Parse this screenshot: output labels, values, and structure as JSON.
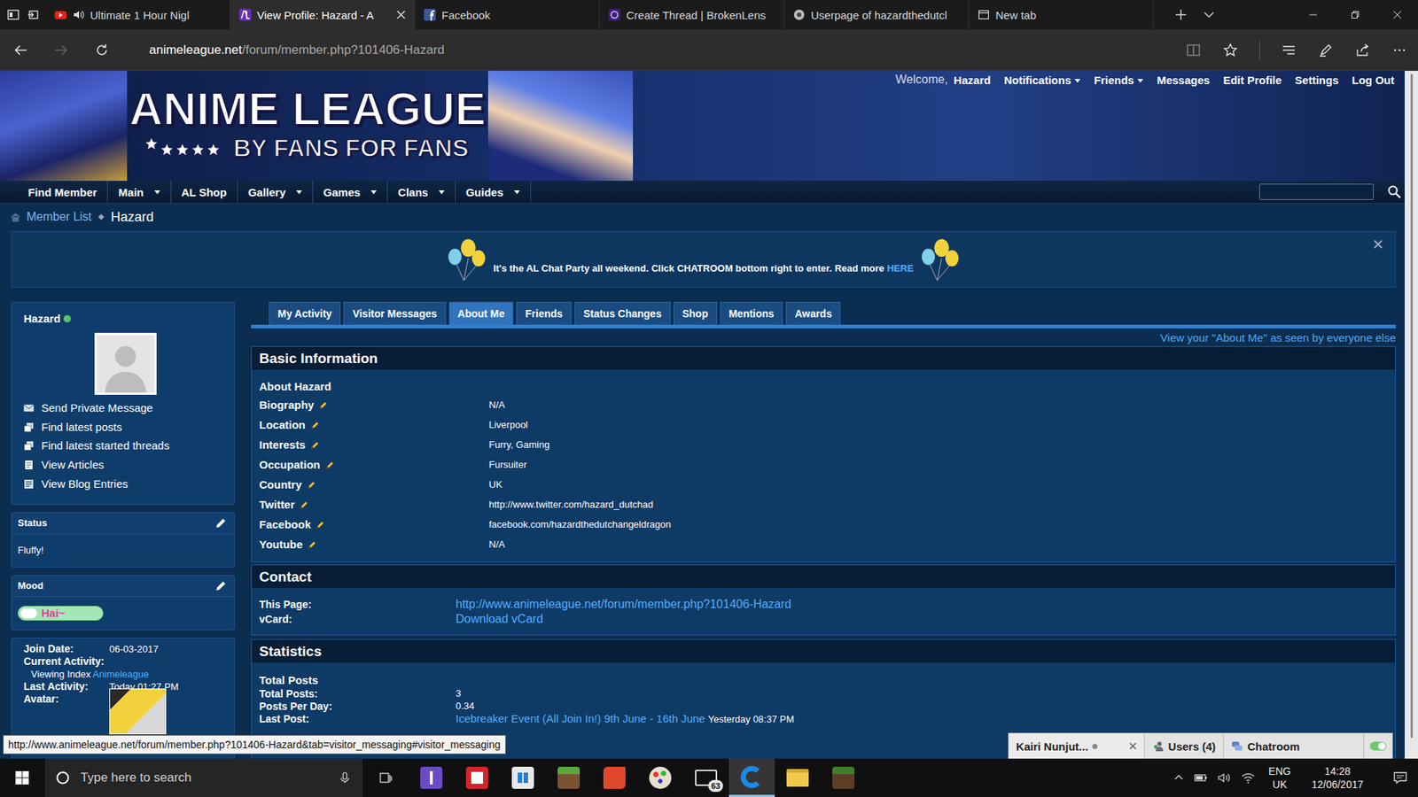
{
  "browser": {
    "tabs": [
      {
        "title": "Ultimate 1 Hour Nigl",
        "kind": "youtube",
        "audio": true,
        "selected": false
      },
      {
        "title": "View Profile: Hazard - A",
        "kind": "animeleague",
        "audio": false,
        "selected": true
      },
      {
        "title": "Facebook",
        "kind": "facebook",
        "audio": false,
        "selected": false
      },
      {
        "title": "Create Thread | BrokenLens",
        "kind": "brokenlens",
        "audio": false,
        "selected": false
      },
      {
        "title": "Userpage of hazardthedutcl",
        "kind": "userpage",
        "audio": false,
        "selected": false
      },
      {
        "title": "New tab",
        "kind": "newtab",
        "audio": false,
        "selected": false
      }
    ],
    "can_go_back": true,
    "can_go_forward": false,
    "url": {
      "host": "animeleague.net",
      "path": "/forum/member.php?101406-Hazard"
    },
    "status_url": "http://www.animeleague.net/forum/member.php?101406-Hazard&tab=visitor_messaging#visitor_messaging"
  },
  "site": {
    "logo": {
      "title": "ANIME LEAGUE",
      "tagline": "BY FANS FOR FANS"
    },
    "welcome": "Welcome,",
    "username": "Hazard",
    "user_links": [
      {
        "label": "Notifications",
        "dropdown": true
      },
      {
        "label": "Friends",
        "dropdown": true
      },
      {
        "label": "Messages",
        "dropdown": false
      },
      {
        "label": "Edit Profile",
        "dropdown": false
      },
      {
        "label": "Settings",
        "dropdown": false
      },
      {
        "label": "Log Out",
        "dropdown": false
      }
    ],
    "nav": [
      {
        "label": "Find Member",
        "dropdown": false
      },
      {
        "label": "Main",
        "dropdown": true
      },
      {
        "label": "AL Shop",
        "dropdown": false
      },
      {
        "label": "Gallery",
        "dropdown": true
      },
      {
        "label": "Games",
        "dropdown": true
      },
      {
        "label": "Clans",
        "dropdown": true
      },
      {
        "label": "Guides",
        "dropdown": true
      }
    ],
    "breadcrumb": [
      {
        "label": "Member List",
        "link": true
      },
      {
        "label": "Hazard",
        "link": false
      }
    ],
    "notice": {
      "text": "It's the AL Chat Party all weekend. Click CHATROOM bottom right to enter. Read more ",
      "link": "HERE"
    }
  },
  "sidebar": {
    "name": "Hazard",
    "online": true,
    "actions": [
      {
        "label": "Send Private Message",
        "kind": "message"
      },
      {
        "label": "Find latest posts",
        "kind": "posts"
      },
      {
        "label": "Find latest started threads",
        "kind": "posts"
      },
      {
        "label": "View Articles",
        "kind": "articles"
      },
      {
        "label": "View Blog Entries",
        "kind": "blog"
      }
    ],
    "boxes": [
      {
        "title": "Status",
        "text": "Fluffy!",
        "kind": "text"
      },
      {
        "title": "Mood",
        "text": "Hai~",
        "kind": "mood"
      }
    ],
    "stats": [
      {
        "kind": "text",
        "label": "Join Date:",
        "value": "06-03-2017"
      },
      {
        "kind": "activity",
        "label": "Current Activity:",
        "detail": "Viewing Index",
        "link": "Animeleague"
      },
      {
        "kind": "text",
        "label": "Last Activity:",
        "value": "Today 01:27 PM"
      },
      {
        "kind": "image",
        "label": "Avatar:"
      }
    ]
  },
  "profile": {
    "tabs": [
      {
        "label": "My Activity",
        "selected": false
      },
      {
        "label": "Visitor Messages",
        "selected": false
      },
      {
        "label": "About Me",
        "selected": true
      },
      {
        "label": "Friends",
        "selected": false
      },
      {
        "label": "Status Changes",
        "selected": false
      },
      {
        "label": "Shop",
        "selected": false
      },
      {
        "label": "Mentions",
        "selected": false
      },
      {
        "label": "Awards",
        "selected": false
      }
    ],
    "view_as_link": "View your \"About Me\" as seen by everyone else",
    "sections": [
      {
        "title": "Basic Information",
        "kind": "editable",
        "subtitle": "About Hazard",
        "rows": [
          {
            "label": "Biography",
            "value": "N/A",
            "link": false
          },
          {
            "label": "Location",
            "value": "Liverpool",
            "link": false
          },
          {
            "label": "Interests",
            "value": "Furry, Gaming",
            "link": false
          },
          {
            "label": "Occupation",
            "value": "Fursuiter",
            "link": false
          },
          {
            "label": "Country",
            "value": "UK",
            "link": false
          },
          {
            "label": "Twitter",
            "value": "http://www.twitter.com/hazard_dutchad",
            "link": false
          },
          {
            "label": "Facebook",
            "value": "facebook.com/hazardthedutchangeldragon",
            "link": false
          },
          {
            "label": "Youtube",
            "value": "N/A",
            "link": false
          }
        ]
      },
      {
        "title": "Contact",
        "kind": "contact",
        "rows": [
          {
            "label": "This Page:",
            "value": "http://www.animeleague.net/forum/member.php?101406-Hazard",
            "link": true
          },
          {
            "label": "vCard:",
            "value": "Download vCard",
            "link": true
          }
        ]
      },
      {
        "title": "Statistics",
        "kind": "stats",
        "subtitle": "Total Posts",
        "rows": [
          {
            "label": "Total Posts:",
            "value": "3",
            "link": false
          },
          {
            "label": "Posts Per Day:",
            "value": "0.34",
            "link": false
          },
          {
            "label": "Last Post:",
            "value": "Icebreaker Event (All Join In!) 9th June - 16th June",
            "link": true,
            "extra": "Yesterday 08:37 PM"
          }
        ]
      }
    ]
  },
  "chat": {
    "user": "Kairi Nunjut...",
    "user_online": false,
    "users": "Users (4)",
    "room": "Chatroom",
    "enabled": true
  },
  "taskbar": {
    "search_placeholder": "Type here to search",
    "apps": [
      {
        "kind": "hourglass",
        "active": false
      },
      {
        "kind": "reader",
        "active": false
      },
      {
        "kind": "store",
        "active": false
      },
      {
        "kind": "minecraft",
        "active": false
      },
      {
        "kind": "redapp",
        "active": false
      },
      {
        "kind": "paint",
        "active": false
      },
      {
        "kind": "mail",
        "active": false,
        "badge": "63"
      },
      {
        "kind": "edge",
        "active": true
      },
      {
        "kind": "explorer",
        "active": false
      },
      {
        "kind": "minecraft2",
        "active": false
      }
    ],
    "language": "ENG",
    "region": "UK",
    "time": "14:28",
    "date": "12/06/2017"
  }
}
